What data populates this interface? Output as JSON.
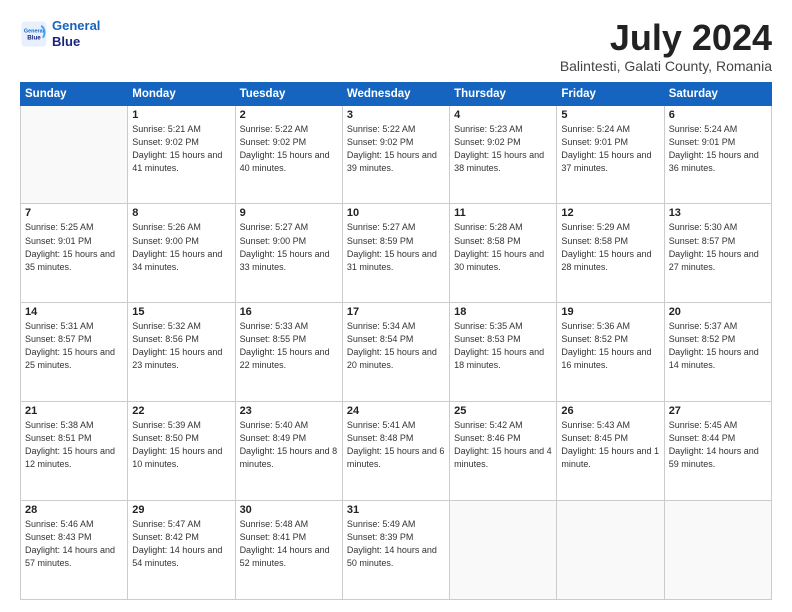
{
  "logo": {
    "line1": "General",
    "line2": "Blue"
  },
  "title": "July 2024",
  "subtitle": "Balintesti, Galati County, Romania",
  "weekdays": [
    "Sunday",
    "Monday",
    "Tuesday",
    "Wednesday",
    "Thursday",
    "Friday",
    "Saturday"
  ],
  "weeks": [
    [
      {
        "day": "",
        "info": ""
      },
      {
        "day": "1",
        "sunrise": "5:21 AM",
        "sunset": "9:02 PM",
        "daylight": "15 hours and 41 minutes."
      },
      {
        "day": "2",
        "sunrise": "5:22 AM",
        "sunset": "9:02 PM",
        "daylight": "15 hours and 40 minutes."
      },
      {
        "day": "3",
        "sunrise": "5:22 AM",
        "sunset": "9:02 PM",
        "daylight": "15 hours and 39 minutes."
      },
      {
        "day": "4",
        "sunrise": "5:23 AM",
        "sunset": "9:02 PM",
        "daylight": "15 hours and 38 minutes."
      },
      {
        "day": "5",
        "sunrise": "5:24 AM",
        "sunset": "9:01 PM",
        "daylight": "15 hours and 37 minutes."
      },
      {
        "day": "6",
        "sunrise": "5:24 AM",
        "sunset": "9:01 PM",
        "daylight": "15 hours and 36 minutes."
      }
    ],
    [
      {
        "day": "7",
        "sunrise": "5:25 AM",
        "sunset": "9:01 PM",
        "daylight": "15 hours and 35 minutes."
      },
      {
        "day": "8",
        "sunrise": "5:26 AM",
        "sunset": "9:00 PM",
        "daylight": "15 hours and 34 minutes."
      },
      {
        "day": "9",
        "sunrise": "5:27 AM",
        "sunset": "9:00 PM",
        "daylight": "15 hours and 33 minutes."
      },
      {
        "day": "10",
        "sunrise": "5:27 AM",
        "sunset": "8:59 PM",
        "daylight": "15 hours and 31 minutes."
      },
      {
        "day": "11",
        "sunrise": "5:28 AM",
        "sunset": "8:58 PM",
        "daylight": "15 hours and 30 minutes."
      },
      {
        "day": "12",
        "sunrise": "5:29 AM",
        "sunset": "8:58 PM",
        "daylight": "15 hours and 28 minutes."
      },
      {
        "day": "13",
        "sunrise": "5:30 AM",
        "sunset": "8:57 PM",
        "daylight": "15 hours and 27 minutes."
      }
    ],
    [
      {
        "day": "14",
        "sunrise": "5:31 AM",
        "sunset": "8:57 PM",
        "daylight": "15 hours and 25 minutes."
      },
      {
        "day": "15",
        "sunrise": "5:32 AM",
        "sunset": "8:56 PM",
        "daylight": "15 hours and 23 minutes."
      },
      {
        "day": "16",
        "sunrise": "5:33 AM",
        "sunset": "8:55 PM",
        "daylight": "15 hours and 22 minutes."
      },
      {
        "day": "17",
        "sunrise": "5:34 AM",
        "sunset": "8:54 PM",
        "daylight": "15 hours and 20 minutes."
      },
      {
        "day": "18",
        "sunrise": "5:35 AM",
        "sunset": "8:53 PM",
        "daylight": "15 hours and 18 minutes."
      },
      {
        "day": "19",
        "sunrise": "5:36 AM",
        "sunset": "8:52 PM",
        "daylight": "15 hours and 16 minutes."
      },
      {
        "day": "20",
        "sunrise": "5:37 AM",
        "sunset": "8:52 PM",
        "daylight": "15 hours and 14 minutes."
      }
    ],
    [
      {
        "day": "21",
        "sunrise": "5:38 AM",
        "sunset": "8:51 PM",
        "daylight": "15 hours and 12 minutes."
      },
      {
        "day": "22",
        "sunrise": "5:39 AM",
        "sunset": "8:50 PM",
        "daylight": "15 hours and 10 minutes."
      },
      {
        "day": "23",
        "sunrise": "5:40 AM",
        "sunset": "8:49 PM",
        "daylight": "15 hours and 8 minutes."
      },
      {
        "day": "24",
        "sunrise": "5:41 AM",
        "sunset": "8:48 PM",
        "daylight": "15 hours and 6 minutes."
      },
      {
        "day": "25",
        "sunrise": "5:42 AM",
        "sunset": "8:46 PM",
        "daylight": "15 hours and 4 minutes."
      },
      {
        "day": "26",
        "sunrise": "5:43 AM",
        "sunset": "8:45 PM",
        "daylight": "15 hours and 1 minute."
      },
      {
        "day": "27",
        "sunrise": "5:45 AM",
        "sunset": "8:44 PM",
        "daylight": "14 hours and 59 minutes."
      }
    ],
    [
      {
        "day": "28",
        "sunrise": "5:46 AM",
        "sunset": "8:43 PM",
        "daylight": "14 hours and 57 minutes."
      },
      {
        "day": "29",
        "sunrise": "5:47 AM",
        "sunset": "8:42 PM",
        "daylight": "14 hours and 54 minutes."
      },
      {
        "day": "30",
        "sunrise": "5:48 AM",
        "sunset": "8:41 PM",
        "daylight": "14 hours and 52 minutes."
      },
      {
        "day": "31",
        "sunrise": "5:49 AM",
        "sunset": "8:39 PM",
        "daylight": "14 hours and 50 minutes."
      },
      {
        "day": "",
        "info": ""
      },
      {
        "day": "",
        "info": ""
      },
      {
        "day": "",
        "info": ""
      }
    ]
  ]
}
